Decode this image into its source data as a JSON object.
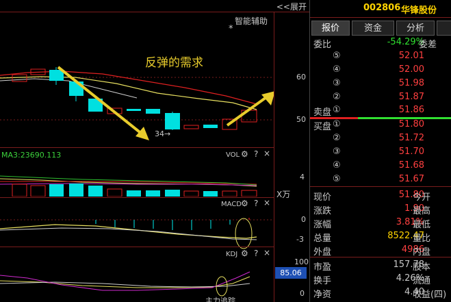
{
  "chart": {
    "expand_label": "<<展开",
    "assist_label": "智能辅助",
    "star": "*",
    "annotation": "反弹的需求",
    "low_marker": "34→",
    "price_axis": [
      "60",
      "50"
    ],
    "vol_title": "VOL",
    "vol_axis": [
      "4",
      "X万"
    ],
    "ma3_label": "MA3:23690.113",
    "macd_title": "MACD",
    "macd_axis": [
      "0",
      "-3"
    ],
    "kdj_title": "KDJ",
    "kdj_axis": [
      "100",
      "0"
    ],
    "kdj_value": "85.06",
    "bottom_title": "主力追踪",
    "ctrl_gear": "⚙",
    "ctrl_help": "?",
    "ctrl_close": "×"
  },
  "stock": {
    "code": "002806",
    "name": "华锋股份",
    "tabs": [
      "报价",
      "资金",
      "分析",
      ""
    ],
    "active_tab": 0,
    "weibi_label": "委比",
    "weibi_value": "-54.29%",
    "weicha_label": "委差",
    "sell_label": "卖盘",
    "buy_label": "买盘",
    "sell": [
      {
        "level": "⑤",
        "price": "52.01"
      },
      {
        "level": "④",
        "price": "52.00"
      },
      {
        "level": "③",
        "price": "51.98"
      },
      {
        "level": "②",
        "price": "51.87"
      },
      {
        "level": "①",
        "price": "51.86"
      }
    ],
    "buy": [
      {
        "level": "①",
        "price": "51.80"
      },
      {
        "level": "②",
        "price": "51.72"
      },
      {
        "level": "③",
        "price": "51.70"
      },
      {
        "level": "④",
        "price": "51.68"
      },
      {
        "level": "⑤",
        "price": "51.67"
      }
    ],
    "quote": [
      {
        "label": "现价",
        "value": "51.80",
        "label2": "今开",
        "color": "#ff4040"
      },
      {
        "label": "涨跌",
        "value": "1.90",
        "label2": "最高",
        "color": "#ff4040"
      },
      {
        "label": "涨幅",
        "value": "3.81%",
        "label2": "最低",
        "color": "#ff4040"
      },
      {
        "label": "总量",
        "value": "8522.47",
        "label2": "量比",
        "color": "#ffd400"
      },
      {
        "label": "外盘",
        "value": "4986",
        "label2": "内盘",
        "color": "#ff4040"
      },
      {
        "label": "市盈",
        "value": "157.78",
        "label2": "股本",
        "color": "#c8c8c8"
      },
      {
        "label": "换手",
        "value": "4.26%",
        "label2": "流通",
        "color": "#c8c8c8"
      },
      {
        "label": "净资",
        "value": "4.40",
        "label2": "收益(四)",
        "color": "#c8c8c8"
      }
    ]
  }
}
